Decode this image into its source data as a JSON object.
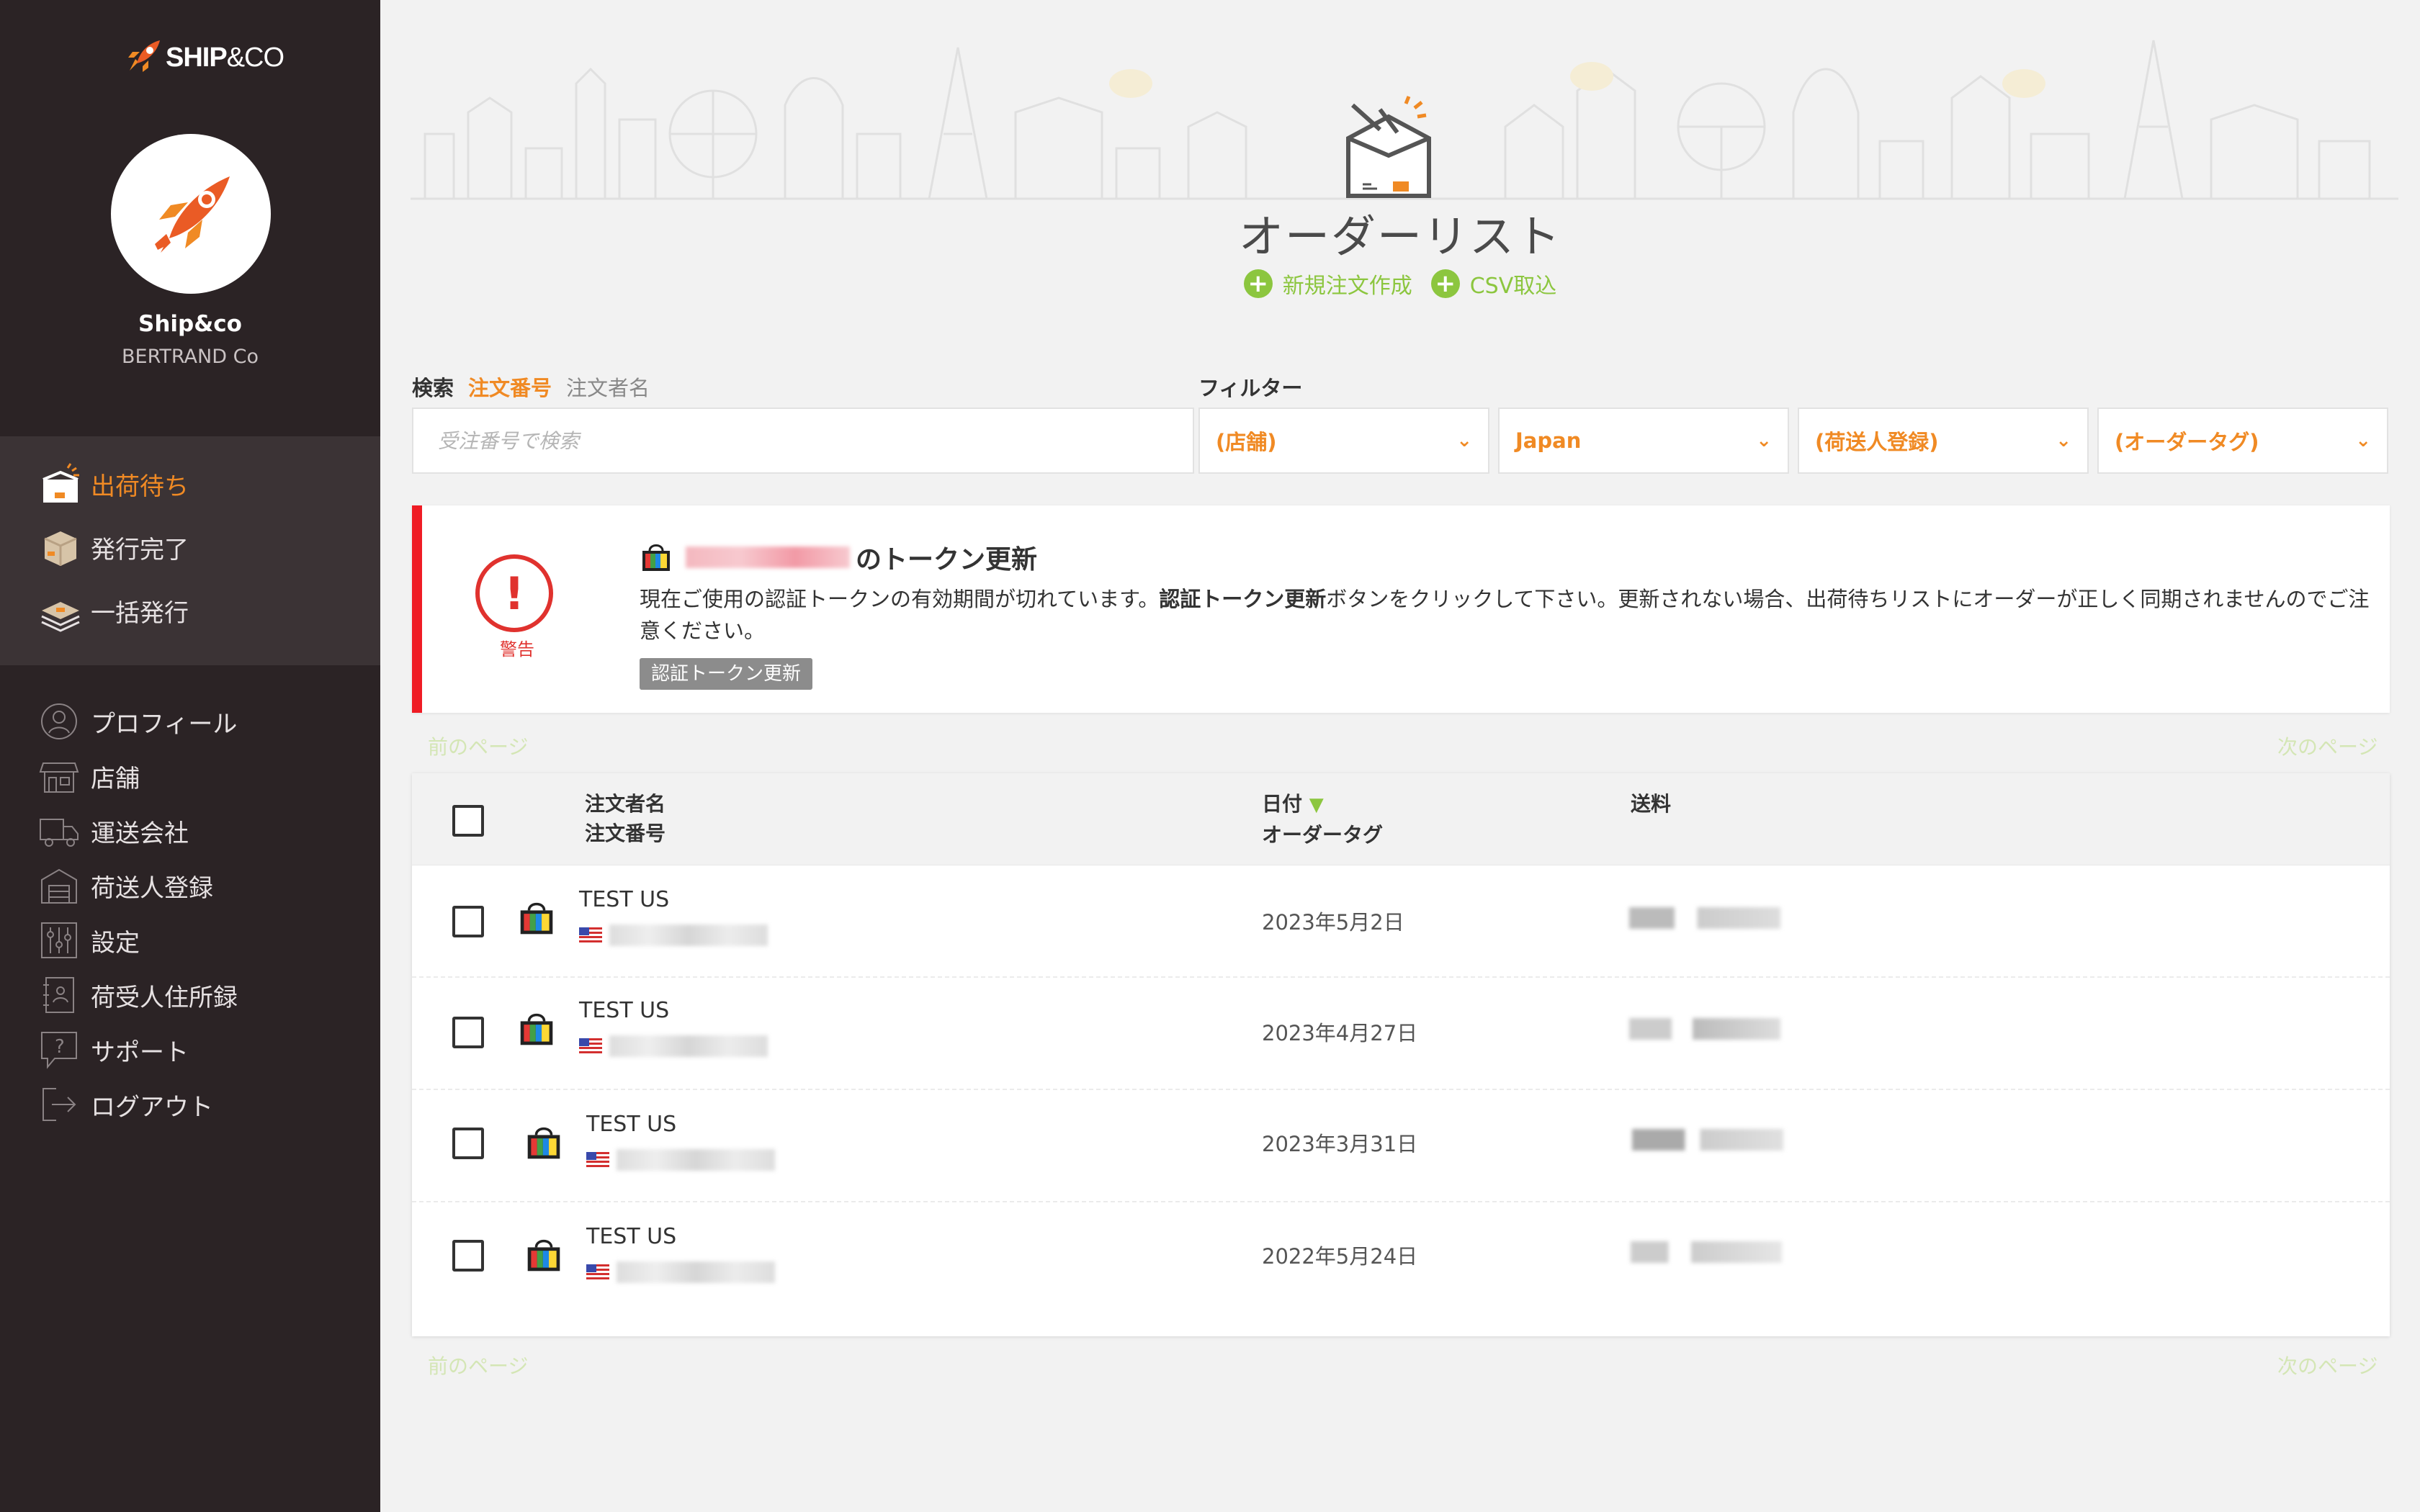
{
  "brand": {
    "logo_text_main": "SHIP",
    "logo_text_suffix": "&CO"
  },
  "account": {
    "name": "Ship&co",
    "company": "BERTRAND Co"
  },
  "nav_primary": [
    {
      "label": "出荷待ち",
      "icon": "box-open-icon",
      "active": true
    },
    {
      "label": "発行完了",
      "icon": "package-icon",
      "active": false
    },
    {
      "label": "一括発行",
      "icon": "stack-icon",
      "active": false
    }
  ],
  "nav_secondary": [
    {
      "label": "プロフィール",
      "icon": "user-icon"
    },
    {
      "label": "店舗",
      "icon": "store-icon"
    },
    {
      "label": "運送会社",
      "icon": "truck-icon"
    },
    {
      "label": "荷送人登録",
      "icon": "warehouse-icon"
    },
    {
      "label": "設定",
      "icon": "sliders-icon"
    },
    {
      "label": "荷受人住所録",
      "icon": "address-book-icon"
    },
    {
      "label": "サポート",
      "icon": "help-icon"
    },
    {
      "label": "ログアウト",
      "icon": "logout-icon"
    }
  ],
  "page": {
    "title": "オーダーリスト",
    "action_new": "新規注文作成",
    "action_csv": "CSV取込"
  },
  "search": {
    "label": "検索",
    "mode_active": "注文番号",
    "mode_inactive": "注文者名",
    "placeholder": "受注番号で検索"
  },
  "filter": {
    "label": "フィルター",
    "selects": [
      "(店舗)",
      "Japan",
      "(荷送人登録)",
      "(オーダータグ)"
    ]
  },
  "alert": {
    "title_suffix": "のトークン更新",
    "icon_label": "警告",
    "body_pre": "現在ご使用の認証トークンの有効期間が切れています。",
    "body_bold": "認証トークン更新",
    "body_post": "ボタンをクリックして下さい。更新されない場合、出荷待ちリストにオーダーが正しく同期されませんのでご注意ください。",
    "button": "認証トークン更新"
  },
  "pagination": {
    "prev": "前のページ",
    "next": "次のページ"
  },
  "table": {
    "col_name_1": "注文者名",
    "col_name_2": "注文番号",
    "col_date_1": "日付",
    "sort_indicator": "▼",
    "col_date_2": "オーダータグ",
    "col_shipping": "送料",
    "rows": [
      {
        "name": "TEST US",
        "date": "2023年5月2日"
      },
      {
        "name": "TEST US",
        "date": "2023年4月27日"
      },
      {
        "name": "TEST US",
        "date": "2023年3月31日"
      },
      {
        "name": "TEST US",
        "date": "2022年5月24日"
      }
    ]
  },
  "colors": {
    "accent": "#f08a24",
    "green": "#8cc63f",
    "danger": "#ef1c24",
    "sidebar": "#2b2325"
  }
}
